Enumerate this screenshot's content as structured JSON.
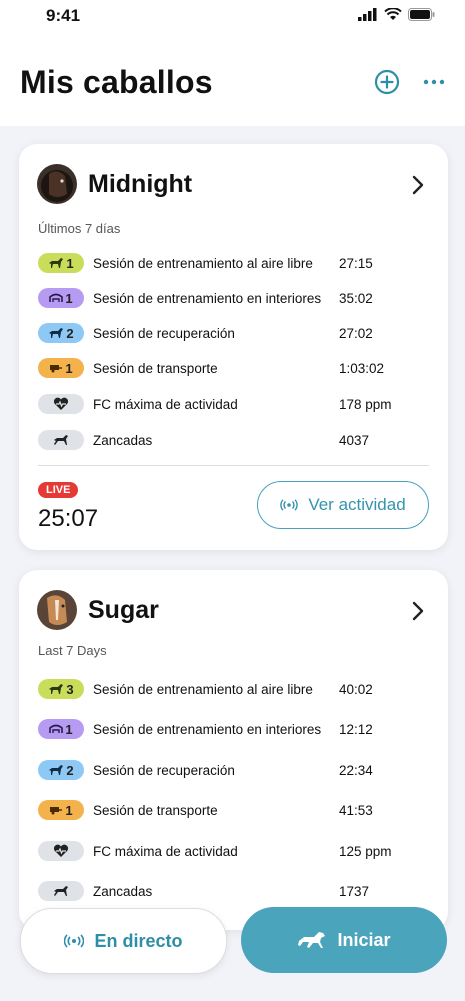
{
  "status_bar": {
    "time": "9:41"
  },
  "page": {
    "title": "Mis caballos"
  },
  "horses": [
    {
      "name": "Midnight",
      "period": "Últimos 7 días",
      "stats": [
        {
          "badge": "1",
          "badge_color": "#c9dd5a",
          "icon": "horse-outdoor-icon",
          "label": "Sesión de entrenamiento al aire libre",
          "value": "27:15"
        },
        {
          "badge": "1",
          "badge_color": "#b79bf2",
          "icon": "arena-indoor-icon",
          "label": "Sesión de entrenamiento en interiores",
          "value": "35:02"
        },
        {
          "badge": "2",
          "badge_color": "#8ec9f5",
          "icon": "horse-recovery-icon",
          "label": "Sesión de recuperación",
          "value": "27:02"
        },
        {
          "badge": "1",
          "badge_color": "#f3b24c",
          "icon": "trailer-icon",
          "label": "Sesión de transporte",
          "value": "1:03:02"
        },
        {
          "badge": "",
          "badge_color": "#dfe2e7",
          "icon": "heart-rate-icon",
          "label": "FC máxima de actividad",
          "value": "178 ppm"
        },
        {
          "badge": "",
          "badge_color": "#dfe2e7",
          "icon": "horse-stride-icon",
          "label": "Zancadas",
          "value": "4037"
        }
      ],
      "live": {
        "badge": "LIVE",
        "time": "25:07",
        "button": "Ver actividad"
      }
    },
    {
      "name": "Sugar",
      "period": "Last 7 Days",
      "stats": [
        {
          "badge": "3",
          "badge_color": "#c9dd5a",
          "icon": "horse-outdoor-icon",
          "label": "Sesión de entrenamiento al aire libre",
          "value": "40:02"
        },
        {
          "badge": "1",
          "badge_color": "#b79bf2",
          "icon": "arena-indoor-icon",
          "label": "Sesión de entrenamiento en interiores",
          "value": "12:12"
        },
        {
          "badge": "2",
          "badge_color": "#8ec9f5",
          "icon": "horse-recovery-icon",
          "label": "Sesión de recuperación",
          "value": "22:34"
        },
        {
          "badge": "1",
          "badge_color": "#f3b24c",
          "icon": "trailer-icon",
          "label": "Sesión de transporte",
          "value": "41:53"
        },
        {
          "badge": "",
          "badge_color": "#dfe2e7",
          "icon": "heart-rate-icon",
          "label": "FC máxima de actividad",
          "value": "125 ppm"
        },
        {
          "badge": "",
          "badge_color": "#dfe2e7",
          "icon": "horse-stride-icon",
          "label": "Zancadas",
          "value": "1737"
        }
      ]
    }
  ],
  "bottom_bar": {
    "live_label": "En directo",
    "start_label": "Iniciar"
  },
  "colors": {
    "accent": "#4aa4bc",
    "live_red": "#e53935"
  }
}
